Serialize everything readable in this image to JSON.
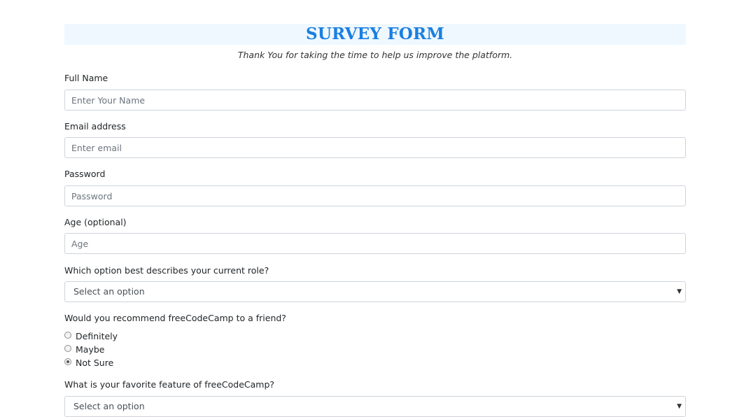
{
  "header": {
    "title": "SURVEY FORM",
    "subtitle": "Thank You for taking the time to help us improve the platform."
  },
  "fields": {
    "name": {
      "label": "Full Name",
      "placeholder": "Enter Your Name"
    },
    "email": {
      "label": "Email address",
      "placeholder": "Enter email"
    },
    "password": {
      "label": "Password",
      "placeholder": "Password"
    },
    "age": {
      "label": "Age (optional)",
      "placeholder": "Age"
    },
    "role": {
      "label": "Which option best describes your current role?",
      "selected": "Select an option"
    },
    "recommend": {
      "label": "Would you recommend freeCodeCamp to a friend?",
      "options": [
        "Definitely",
        "Maybe",
        "Not Sure"
      ],
      "checked_index": 2
    },
    "feature": {
      "label": "What is your favorite feature of freeCodeCamp?",
      "selected": "Select an option"
    }
  },
  "icons": {
    "dropdown_caret": "▼"
  },
  "colors": {
    "title": "#1a7fe0",
    "title_bg": "#f0f8ff",
    "border": "#ced4da"
  }
}
